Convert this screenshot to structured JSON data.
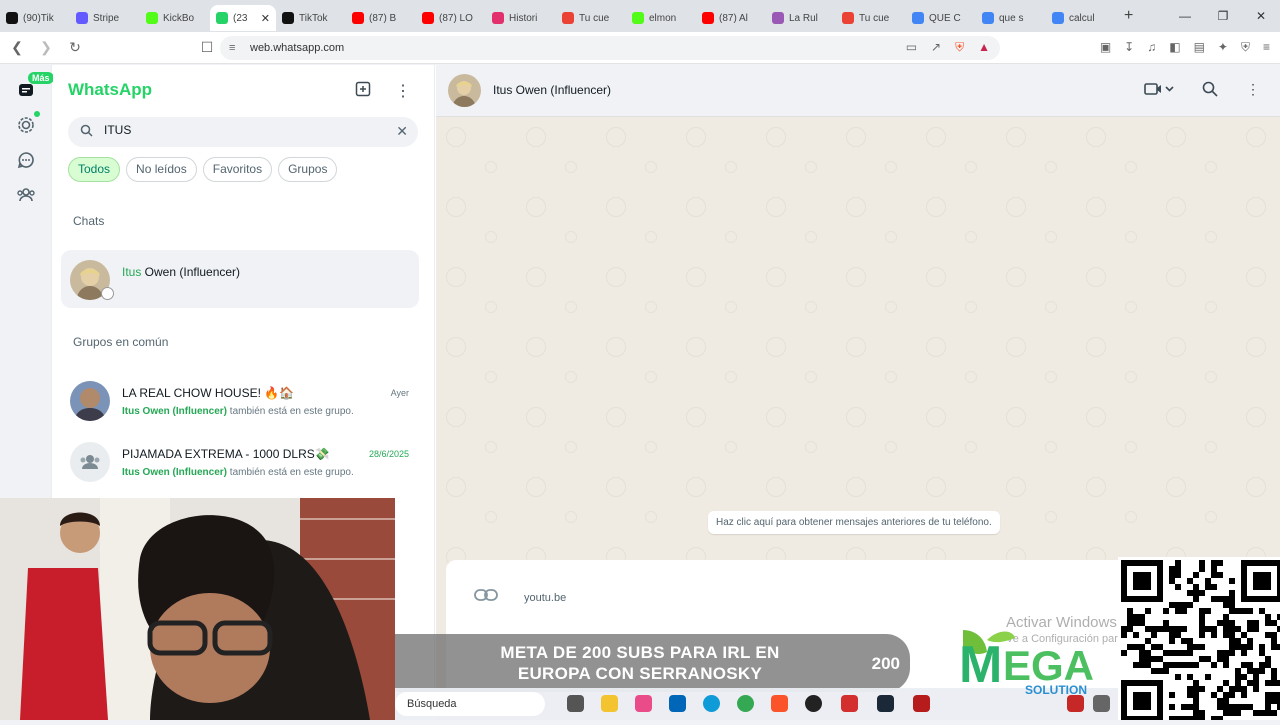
{
  "browser": {
    "tabs": [
      {
        "label": "(90)Tik",
        "color": "#111111"
      },
      {
        "label": "Stripe",
        "color": "#635bff"
      },
      {
        "label": "KickBo",
        "color": "#53fc18"
      },
      {
        "label": "(23",
        "color": "#25d366",
        "active": true
      },
      {
        "label": "TikTok",
        "color": "#111111"
      },
      {
        "label": "(87) B",
        "color": "#ff0000"
      },
      {
        "label": "(87) LO",
        "color": "#ff0000"
      },
      {
        "label": "Histori",
        "color": "#e1306c"
      },
      {
        "label": "Tu cue",
        "color": "#ea4335"
      },
      {
        "label": "elmon",
        "color": "#53fc18"
      },
      {
        "label": "(87) Al",
        "color": "#ff0000"
      },
      {
        "label": "La Rul",
        "color": "#9b59b6"
      },
      {
        "label": "Tu cue",
        "color": "#ea4335"
      },
      {
        "label": "QUE C",
        "color": "#4285f4"
      },
      {
        "label": "que s",
        "color": "#4285f4"
      },
      {
        "label": "calcul",
        "color": "#4285f4"
      }
    ],
    "url": "web.whatsapp.com"
  },
  "rail": {
    "badge": "Más"
  },
  "sidebar": {
    "title": "WhatsApp",
    "search_value": "ITUS",
    "filters": [
      "Todos",
      "No leídos",
      "Favoritos",
      "Grupos"
    ],
    "chats_heading": "Chats",
    "chat": {
      "highlight": "Itus",
      "rest": " Owen (Influencer)"
    },
    "groups_heading": "Grupos en común",
    "groups": [
      {
        "name": "LA REAL CHOW HOUSE! 🔥🏠",
        "time": "Ayer",
        "member": "Itus Owen (Influencer)",
        "suffix": " también está en este grupo."
      },
      {
        "name": "PIJAMADA EXTREMA - 1000 DLRS💸",
        "time": "28/6/2025",
        "member": "Itus Owen (Influencer)",
        "suffix": " también está en este grupo."
      }
    ]
  },
  "conversation": {
    "contact_name": "Itus Owen (Influencer)",
    "older_messages": "Haz clic aquí para obtener mensajes anteriores de tu teléfono.",
    "link_preview": "youtu.be"
  },
  "overlay": {
    "banner_text": "META DE 200 SUBS PARA IRL EN EUROPA CON SERRANOSKY",
    "banner_count": "200",
    "taskbar_search": "Búsqueda",
    "watermark_title": "Activar Windows",
    "watermark_sub": "Ve a Configuración para activar Windows.",
    "logo_text": "EGA",
    "logo_sub": "SOLUTION"
  }
}
